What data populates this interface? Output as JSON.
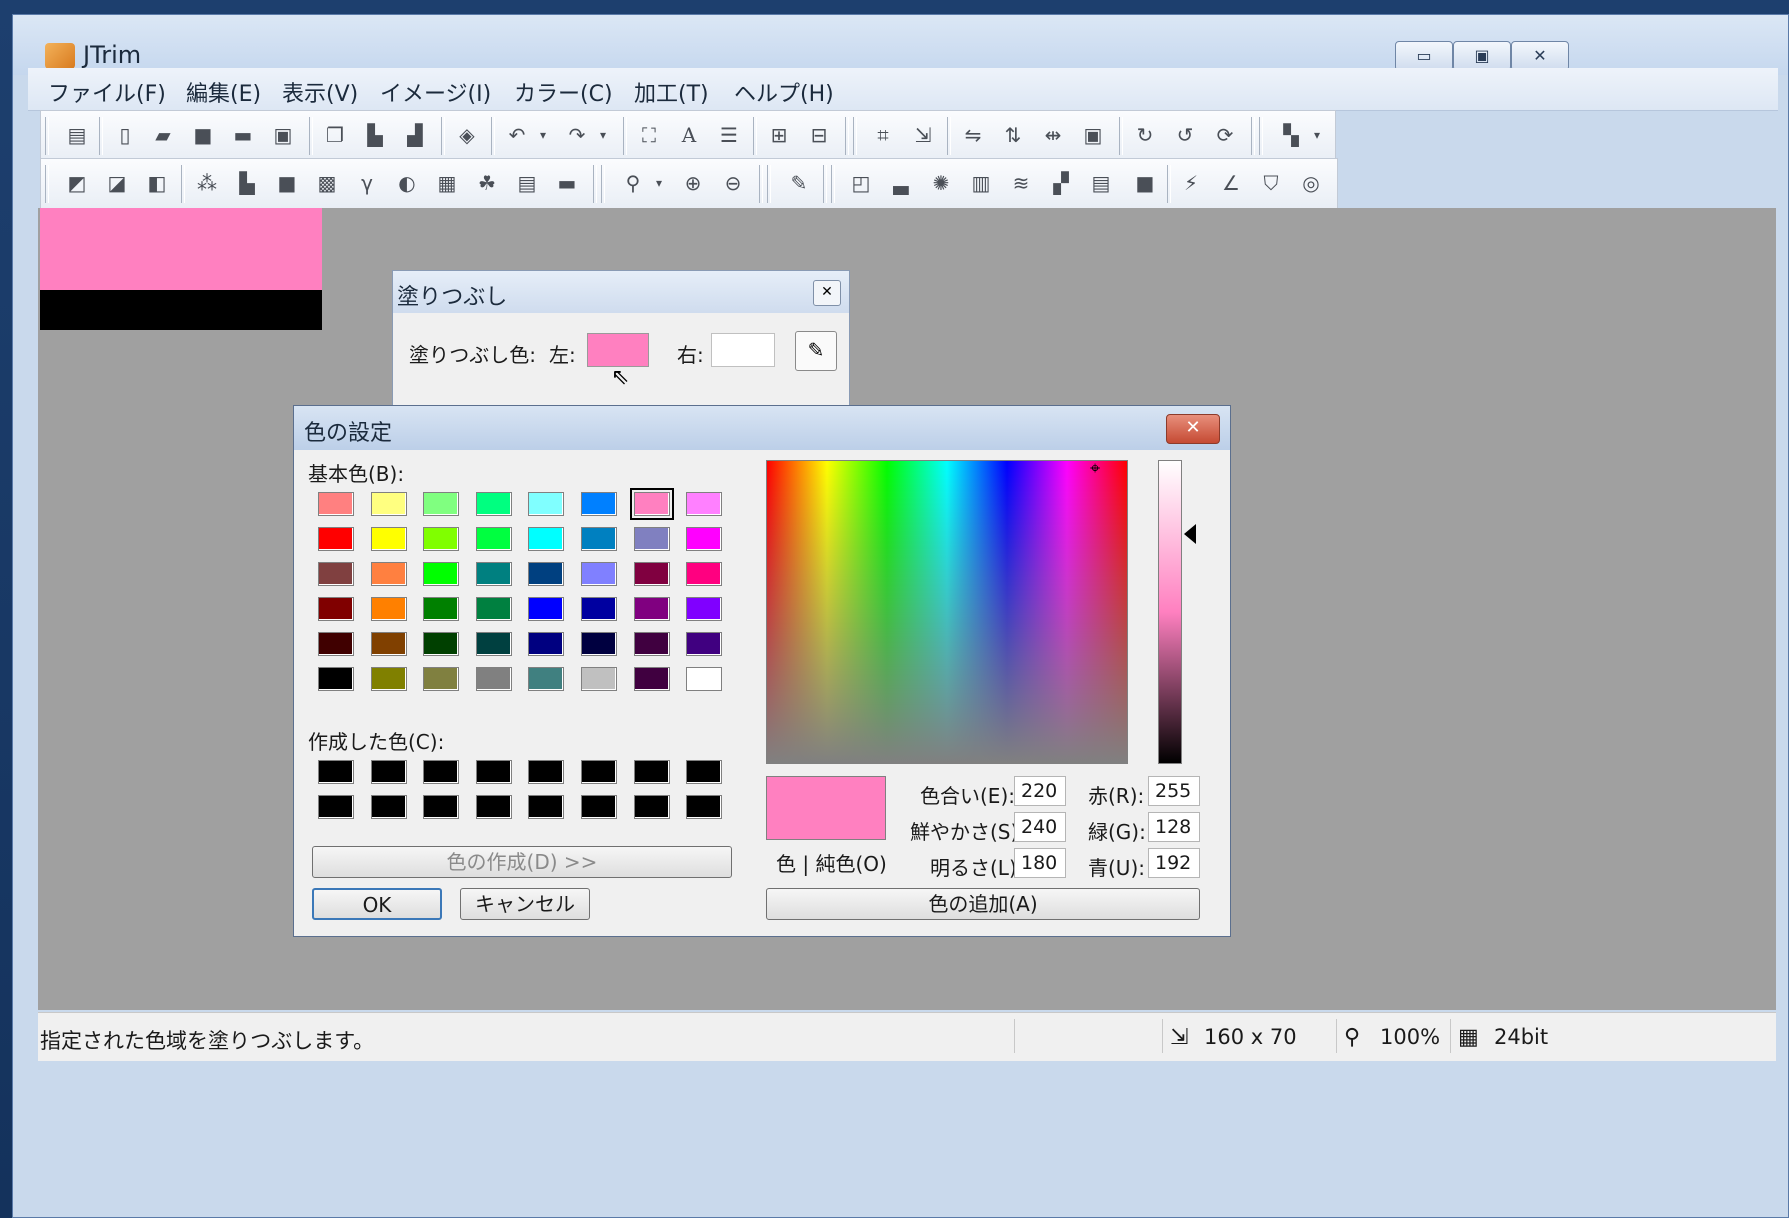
{
  "app": {
    "title": "JTrim"
  },
  "window_buttons": {
    "minimize": "▭",
    "maximize": "▣",
    "close": "✕"
  },
  "menu": [
    "ファイル(F)",
    "編集(E)",
    "表示(V)",
    "イメージ(I)",
    "カラー(C)",
    "加工(T)",
    "ヘルプ(H)"
  ],
  "status": {
    "message": "指定された色域を塗りつぶします。",
    "size": "160 x 70",
    "zoom": "100%",
    "depth": "24bit"
  },
  "fill_dialog": {
    "title": "塗りつぶし",
    "color_label": "塗りつぶし色:",
    "left_label": "左:",
    "right_label": "右:",
    "left_color": "#ff80c0",
    "right_color": "#ffffff"
  },
  "color_dialog": {
    "title": "色の設定",
    "basic_label": "基本色(B):",
    "custom_label": "作成した色(C):",
    "define_button": "色の作成(D) >>",
    "ok": "OK",
    "cancel": "キャンセル",
    "add_button": "色の追加(A)",
    "preview_label": "色 | 純色(O)",
    "preview_color": "#ff80c0",
    "fields": {
      "hue_label": "色合い(E):",
      "hue": "220",
      "sat_label": "鮮やかさ(S):",
      "sat": "240",
      "lum_label": "明るさ(L):",
      "lum": "180",
      "red_label": "赤(R):",
      "red": "255",
      "green_label": "緑(G):",
      "green": "128",
      "blue_label": "青(U):",
      "blue": "192"
    },
    "basic_colors": [
      [
        "#ff8080",
        "#ffff80",
        "#80ff80",
        "#00ff80",
        "#80ffff",
        "#0080ff",
        "#ff80c0",
        "#ff80ff"
      ],
      [
        "#ff0000",
        "#ffff00",
        "#80ff00",
        "#00ff40",
        "#00ffff",
        "#0080c0",
        "#8080c0",
        "#ff00ff"
      ],
      [
        "#804040",
        "#ff8040",
        "#00ff00",
        "#008080",
        "#004080",
        "#8080ff",
        "#800040",
        "#ff0080"
      ],
      [
        "#800000",
        "#ff8000",
        "#008000",
        "#008040",
        "#0000ff",
        "#0000a0",
        "#800080",
        "#8000ff"
      ],
      [
        "#400000",
        "#804000",
        "#004000",
        "#004040",
        "#000080",
        "#000040",
        "#400040",
        "#400080"
      ],
      [
        "#000000",
        "#808000",
        "#808040",
        "#808080",
        "#408080",
        "#c0c0c0",
        "#400040",
        "#ffffff"
      ]
    ],
    "custom_colors": [
      [
        "#000000",
        "#000000",
        "#000000",
        "#000000",
        "#000000",
        "#000000",
        "#000000",
        "#000000"
      ],
      [
        "#000000",
        "#000000",
        "#000000",
        "#000000",
        "#000000",
        "#000000",
        "#000000",
        "#000000"
      ]
    ],
    "selected_basic": [
      0,
      6
    ]
  },
  "canvas_colors": {
    "top": "#ff80c0",
    "bottom": "#000000"
  }
}
